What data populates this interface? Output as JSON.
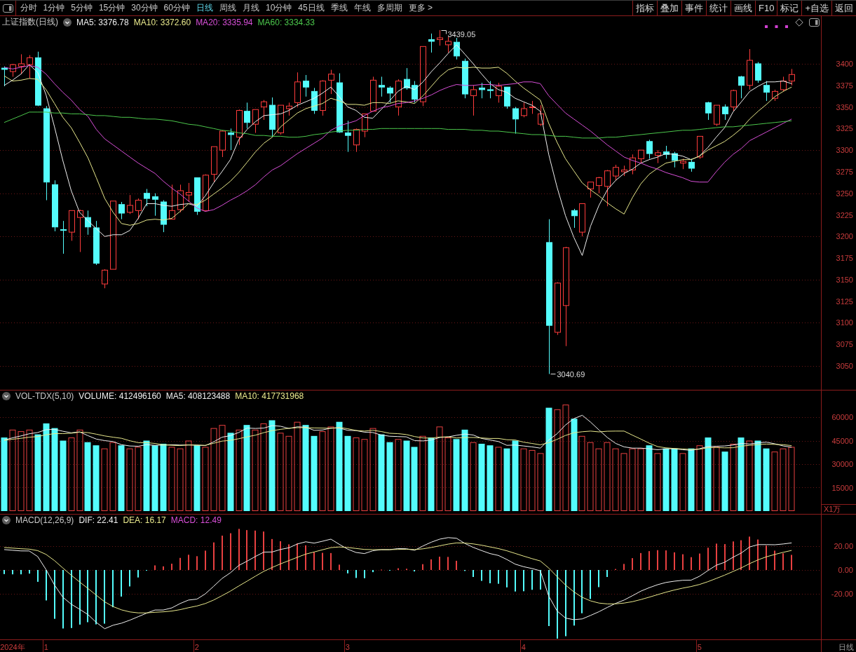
{
  "toolbar": {
    "periods": [
      {
        "label": "分时",
        "selected": false
      },
      {
        "label": "1分钟",
        "selected": false
      },
      {
        "label": "5分钟",
        "selected": false
      },
      {
        "label": "15分钟",
        "selected": false
      },
      {
        "label": "30分钟",
        "selected": false
      },
      {
        "label": "60分钟",
        "selected": false
      },
      {
        "label": "日线",
        "selected": true
      },
      {
        "label": "周线",
        "selected": false
      },
      {
        "label": "月线",
        "selected": false
      },
      {
        "label": "10分钟",
        "selected": false
      },
      {
        "label": "45日线",
        "selected": false
      },
      {
        "label": "季线",
        "selected": false
      },
      {
        "label": "年线",
        "selected": false
      },
      {
        "label": "多周期",
        "selected": false
      },
      {
        "label": "更多 >",
        "selected": false
      }
    ],
    "tools": [
      "指标",
      "叠加",
      "事件",
      "统计",
      "画线",
      "F10",
      "标记",
      "+自选",
      "返回"
    ]
  },
  "price_panel": {
    "title": "上证指数(日线)",
    "legend": [
      {
        "label": "MA5: 3376.78",
        "color": "#f0f0f0"
      },
      {
        "label": "MA10: 3372.60",
        "color": "#e8e88c"
      },
      {
        "label": "MA20: 3335.94",
        "color": "#d84fd8"
      },
      {
        "label": "MA60: 3334.33",
        "color": "#4cc84c"
      }
    ],
    "chart_data": {
      "type": "candlestick",
      "ylim": [
        3021.6,
        3456
      ],
      "grid": true,
      "yticks": [
        3050,
        3075,
        3100,
        3125,
        3150,
        3175,
        3200,
        3225,
        3250,
        3275,
        3300,
        3325,
        3350,
        3375,
        3400
      ],
      "categories": [
        null,
        null,
        null,
        null,
        null,
        null,
        null,
        null,
        null,
        null,
        null,
        null,
        null,
        null,
        null,
        null,
        null,
        null,
        null,
        null,
        null,
        null,
        null,
        null,
        null,
        null,
        null,
        null,
        null,
        null,
        null,
        null,
        null,
        null,
        null,
        null,
        null,
        null,
        null,
        null,
        null,
        null,
        null,
        null,
        null,
        null,
        null,
        null,
        null,
        null,
        null,
        null,
        null,
        null,
        null,
        null,
        null,
        null,
        null,
        null,
        null,
        null,
        null,
        null,
        null,
        null,
        null,
        null,
        null,
        null,
        null,
        null,
        null,
        null,
        null,
        null,
        null,
        null,
        null,
        null,
        null,
        null,
        null,
        null,
        null,
        null,
        null,
        null,
        null,
        null,
        null,
        null,
        null,
        null,
        null,
        null,
        null,
        null
      ],
      "ohlc": [
        [
          3395,
          3397,
          3374,
          3393.5
        ],
        [
          3391,
          3400,
          3385,
          3399
        ],
        [
          3397,
          3411,
          3388,
          3400
        ],
        [
          3399,
          3410,
          3383,
          3407
        ],
        [
          3407,
          3414,
          3351,
          3352
        ],
        [
          3348,
          3351,
          3242,
          3263
        ],
        [
          3260,
          3265,
          3206,
          3211
        ],
        [
          3208,
          3218,
          3180,
          3207
        ],
        [
          3205,
          3230,
          3195,
          3230
        ],
        [
          3222,
          3231,
          3182,
          3230
        ],
        [
          3222,
          3230,
          3202,
          3211
        ],
        [
          3210,
          3218,
          3167,
          3169
        ],
        [
          3145,
          3162,
          3140,
          3161
        ],
        [
          3162,
          3241,
          3162,
          3241
        ],
        [
          3237,
          3240,
          3220,
          3227
        ],
        [
          3228,
          3248,
          3226,
          3236
        ],
        [
          3230,
          3244,
          3220,
          3242
        ],
        [
          3250,
          3255,
          3235,
          3244
        ],
        [
          3246,
          3250,
          3224,
          3243
        ],
        [
          3240,
          3242,
          3205,
          3214
        ],
        [
          3220,
          3260,
          3220,
          3230
        ],
        [
          3231,
          3260,
          3228,
          3253
        ],
        [
          3248,
          3262,
          3240,
          3251
        ],
        [
          3268,
          3268,
          3225,
          3229
        ],
        [
          3230,
          3272,
          3230,
          3271
        ],
        [
          3272,
          3304,
          3263,
          3304
        ],
        [
          3300,
          3323,
          3292,
          3322
        ],
        [
          3320,
          3325,
          3300,
          3318
        ],
        [
          3315,
          3347,
          3306,
          3346
        ],
        [
          3345,
          3355,
          3325,
          3332
        ],
        [
          3330,
          3347,
          3320,
          3347
        ],
        [
          3350,
          3358,
          3335,
          3356
        ],
        [
          3352,
          3361,
          3315,
          3324
        ],
        [
          3320,
          3352,
          3318,
          3352
        ],
        [
          3348,
          3355,
          3340,
          3351
        ],
        [
          3355,
          3390,
          3350,
          3379
        ],
        [
          3380,
          3387,
          3362,
          3373
        ],
        [
          3368,
          3372,
          3342,
          3346
        ],
        [
          3346,
          3381,
          3340,
          3380
        ],
        [
          3381,
          3393,
          3365,
          3388
        ],
        [
          3378,
          3389,
          3320,
          3321
        ],
        [
          3320,
          3334,
          3298,
          3317
        ],
        [
          3306,
          3325,
          3298,
          3324
        ],
        [
          3322,
          3342,
          3315,
          3342
        ],
        [
          3345,
          3385,
          3345,
          3381
        ],
        [
          3375,
          3385,
          3362,
          3373
        ],
        [
          3372,
          3374,
          3355,
          3366
        ],
        [
          3350,
          3382,
          3340,
          3380
        ],
        [
          3382,
          3395,
          3370,
          3372
        ],
        [
          3375,
          3380,
          3355,
          3359
        ],
        [
          3356,
          3420,
          3351,
          3420
        ],
        [
          3428,
          3435,
          3413,
          3426
        ],
        [
          3428,
          3439.05,
          3421,
          3430
        ],
        [
          3422,
          3431,
          3413,
          3426
        ],
        [
          3425,
          3430,
          3405,
          3409
        ],
        [
          3403,
          3406,
          3360,
          3365
        ],
        [
          3363,
          3375,
          3340,
          3370
        ],
        [
          3372,
          3378,
          3360,
          3370
        ],
        [
          3370,
          3380,
          3360,
          3369
        ],
        [
          3363,
          3378,
          3355,
          3374
        ],
        [
          3373,
          3373,
          3348,
          3351
        ],
        [
          3348,
          3350,
          3319,
          3336
        ],
        [
          3340,
          3355,
          3338,
          3348
        ],
        [
          3350,
          3357,
          3342,
          3350
        ],
        [
          3330,
          3352,
          3328,
          3342
        ],
        [
          3193,
          3220,
          3040.69,
          3097
        ],
        [
          3089,
          3147,
          3086,
          3146
        ],
        [
          3120,
          3188,
          3073,
          3187
        ],
        [
          3230,
          3232,
          3210,
          3224
        ],
        [
          3205,
          3238,
          3200,
          3238
        ],
        [
          3255,
          3263,
          3245,
          3263
        ],
        [
          3259,
          3269,
          3250,
          3268
        ],
        [
          3258,
          3277,
          3235,
          3276
        ],
        [
          3270,
          3283,
          3265,
          3280
        ],
        [
          3275,
          3282,
          3270,
          3277
        ],
        [
          3277,
          3295,
          3272,
          3291
        ],
        [
          3290,
          3300,
          3285,
          3300
        ],
        [
          3310,
          3312,
          3290,
          3296
        ],
        [
          3294,
          3300,
          3285,
          3297
        ],
        [
          3298,
          3305,
          3290,
          3295
        ],
        [
          3296,
          3298,
          3280,
          3288
        ],
        [
          3285,
          3290,
          3278,
          3287
        ],
        [
          3286,
          3290,
          3275,
          3279
        ],
        [
          3292,
          3316,
          3290,
          3316
        ],
        [
          3355,
          3356,
          3335,
          3343
        ],
        [
          3330,
          3352,
          3328,
          3352
        ],
        [
          3350,
          3353,
          3335,
          3342
        ],
        [
          3350,
          3370,
          3345,
          3369
        ],
        [
          3385,
          3386,
          3360,
          3375
        ],
        [
          3375,
          3417,
          3370,
          3404
        ],
        [
          3400,
          3402,
          3378,
          3381
        ],
        [
          3375,
          3380,
          3357,
          3367
        ],
        [
          3360,
          3370,
          3357,
          3368
        ],
        [
          3370,
          3385,
          3368,
          3380
        ],
        [
          3380,
          3394,
          3375,
          3387.57
        ],
        null,
        null,
        null
      ],
      "annotations": [
        "3439.05",
        "3040.69"
      ]
    },
    "ma_overlay": {
      "chart_data": {
        "type": "line",
        "ylim": [
          3021.6,
          3456
        ],
        "series": [
          {
            "color": "#f0f0f0",
            "values": [
              3375,
              3381,
              3388,
              3399,
              3390,
              3364,
              3327,
              3288,
              3253,
              3228,
              3218,
              3209,
              3200,
              3202,
              3202,
              3207,
              3221,
              3238,
              3238,
              3236,
              3235,
              3237,
              3238,
              3235,
              3247,
              3262,
              3275,
              3289,
              3312,
              3324,
              3333,
              3340,
              3341,
              3342,
              3346,
              3352,
              3356,
              3360,
              3366,
              3373,
              3362,
              3350,
              3346,
              3338,
              3337,
              3347,
              3357,
              3368,
              3374,
              3370,
              3379,
              3391,
              3401,
              3412,
              3422,
              3411,
              3400,
              3388,
              3377,
              3370,
              3367,
              3360,
              3356,
              3352,
              3345,
              3295,
              3257,
              3224,
              3199,
              3178,
              3212,
              3236,
              3254,
              3265,
              3273,
              3278,
              3285,
              3289,
              3292,
              3296,
              3295,
              3293,
              3289,
              3293,
              3303,
              3315,
              3326,
              3344,
              3356,
              3368,
              3374,
              3379,
              3379,
              3380,
              3377,
              null,
              null,
              null
            ]
          },
          {
            "color": "#e8e88c",
            "values": [
              3386,
              3380,
              3381,
              3383,
              3382,
              3370,
              3354,
              3338,
              3326,
              3309,
              3291,
              3268,
              3244,
              3228,
              3215,
              3213,
              3215,
              3219,
              3220,
              3219,
              3221,
              3229,
              3238,
              3237,
              3242,
              3249,
              3256,
              3264,
              3274,
              3286,
              3298,
              3308,
              3315,
              3327,
              3335,
              3343,
              3348,
              3351,
              3354,
              3360,
              3357,
              3353,
              3353,
              3352,
              3355,
              3355,
              3354,
              3357,
              3356,
              3354,
              3363,
              3374,
              3385,
              3393,
              3396,
              3395,
              3396,
              3395,
              3395,
              3396,
              3389,
              3380,
              3372,
              3365,
              3358,
              3331,
              3309,
              3290,
              3276,
              3262,
              3254,
              3247,
              3239,
              3232,
              3226,
              3245,
              3261,
              3272,
              3279,
              3285,
              3287,
              3289,
              3289,
              3293,
              3300,
              3305,
              3310,
              3317,
              3325,
              3336,
              3345,
              3353,
              3362,
              3368,
              3373,
              null,
              null,
              null
            ]
          },
          {
            "color": "#d84fd8",
            "values": [
              3396,
              3394,
              3396,
              3398,
              3396,
              3388,
              3377,
              3367,
              3358,
              3347,
              3339,
              3324,
              3313,
              3306,
              3299,
              3292,
              3285,
              3279,
              3273,
              3264,
              3256,
              3249,
              3241,
              3233,
              3229,
              3231,
              3236,
              3242,
              3247,
              3253,
              3260,
              3269,
              3277,
              3282,
              3289,
              3296,
              3302,
              3308,
              3314,
              3323,
              3328,
              3331,
              3334,
              3340,
              3345,
              3349,
              3351,
              3354,
              3355,
              3357,
              3360,
              3364,
              3369,
              3373,
              3376,
              3375,
              3375,
              3376,
              3376,
              3375,
              3376,
              3377,
              3379,
              3379,
              3377,
              3363,
              3353,
              3343,
              3336,
              3329,
              3322,
              3314,
              3306,
              3299,
              3292,
              3288,
              3285,
              3281,
              3278,
              3274,
              3271,
              3268,
              3264,
              3263,
              3263,
              3275,
              3286,
              3295,
              3302,
              3311,
              3316,
              3321,
              3326,
              3331,
              3336,
              null,
              null,
              null
            ]
          },
          {
            "color": "#4cc84c",
            "values": [
              3332,
              3336,
              3340,
              3344,
              3344,
              3344,
              3343,
              3343,
              3342,
              3342,
              3341,
              3340,
              3340,
              3339,
              3338,
              3338,
              3337,
              3336,
              3336,
              3335,
              3334,
              3332,
              3330,
              3329,
              3327,
              3325,
              3323,
              3322,
              3320,
              3319,
              3317,
              3317,
              3316,
              3316,
              3315,
              3315,
              3316,
              3318,
              3319,
              3321,
              3322,
              3323,
              3323,
              3324,
              3324,
              3325,
              3325,
              3325,
              3325,
              3325,
              3325,
              3325,
              3325,
              3324,
              3324,
              3324,
              3323,
              3323,
              3322,
              3322,
              3321,
              3320,
              3319,
              3318,
              3318,
              3317,
              3316,
              3316,
              3315,
              3314,
              3314,
              3314,
              3315,
              3315,
              3316,
              3317,
              3318,
              3319,
              3320,
              3321,
              3322,
              3323,
              3323,
              3324,
              3325,
              3326,
              3327,
              3327,
              3328,
              3329,
              3330,
              3331,
              3332,
              3333,
              3334,
              null,
              null,
              null
            ]
          }
        ]
      }
    }
  },
  "volume_panel": {
    "title": "VOL-TDX(5,10)",
    "legend": [
      {
        "label": "VOLUME: 412496160",
        "color": "#f0f0f0"
      },
      {
        "label": "MA5: 408123488",
        "color": "#f0f0f0"
      },
      {
        "label": "MA10: 417731968",
        "color": "#e8e88c"
      }
    ],
    "unit": "X1万",
    "chart_data": {
      "type": "bar",
      "ylim": [
        -2239,
        77463
      ],
      "grid": true,
      "yticks": [
        15000,
        30000,
        45000,
        60000
      ],
      "series": [
        {
          "values": [
            47000,
            52000,
            51000,
            52000,
            49000,
            56000,
            53000,
            45000,
            47000,
            52000,
            44000,
            42000,
            40000,
            44000,
            42000,
            40000,
            41000,
            45000,
            42000,
            43000,
            41000,
            40000,
            45000,
            42000,
            41000,
            53000,
            55000,
            50000,
            52000,
            55000,
            52000,
            56000,
            58000,
            50000,
            48000,
            57000,
            55000,
            48000,
            51000,
            54000,
            57000,
            48000,
            47000,
            46000,
            53000,
            49000,
            44000,
            46000,
            45000,
            41000,
            48000,
            47000,
            54000,
            47000,
            46000,
            52000,
            44000,
            43000,
            42000,
            41000,
            40000,
            45000,
            40000,
            39000,
            37000,
            66000,
            65000,
            68000,
            59000,
            48000,
            44000,
            40000,
            44000,
            40000,
            37000,
            40000,
            40000,
            42000,
            37000,
            40000,
            40000,
            37000,
            40000,
            42000,
            47000,
            41000,
            38000,
            43000,
            47000,
            45000,
            45000,
            40000,
            38000,
            40000,
            41000,
            null,
            null,
            null
          ],
          "colors": [
            "#54fcfc",
            "#e84040",
            "#e84040",
            "#e84040",
            "#54fcfc",
            "#54fcfc",
            "#54fcfc",
            "#54fcfc",
            "#e84040",
            "#e84040",
            "#54fcfc",
            "#54fcfc",
            "#e84040",
            "#e84040",
            "#54fcfc",
            "#e84040",
            "#e84040",
            "#54fcfc",
            "#54fcfc",
            "#54fcfc",
            "#e84040",
            "#e84040",
            "#e84040",
            "#54fcfc",
            "#e84040",
            "#e84040",
            "#e84040",
            "#54fcfc",
            "#e84040",
            "#54fcfc",
            "#e84040",
            "#e84040",
            "#54fcfc",
            "#e84040",
            "#e84040",
            "#e84040",
            "#54fcfc",
            "#54fcfc",
            "#e84040",
            "#e84040",
            "#54fcfc",
            "#54fcfc",
            "#e84040",
            "#e84040",
            "#e84040",
            "#54fcfc",
            "#54fcfc",
            "#e84040",
            "#54fcfc",
            "#54fcfc",
            "#e84040",
            "#54fcfc",
            "#e84040",
            "#e84040",
            "#54fcfc",
            "#54fcfc",
            "#e84040",
            "#54fcfc",
            "#54fcfc",
            "#e84040",
            "#54fcfc",
            "#54fcfc",
            "#e84040",
            "#e84040",
            "#e84040",
            "#54fcfc",
            "#e84040",
            "#e84040",
            "#54fcfc",
            "#e84040",
            "#e84040",
            "#e84040",
            "#e84040",
            "#e84040",
            "#e84040",
            "#e84040",
            "#e84040",
            "#54fcfc",
            "#e84040",
            "#54fcfc",
            "#54fcfc",
            "#e84040",
            "#54fcfc",
            "#e84040",
            "#54fcfc",
            "#e84040",
            "#54fcfc",
            "#e84040",
            "#54fcfc",
            "#e84040",
            "#54fcfc",
            "#54fcfc",
            "#e84040",
            "#e84040",
            "#e84040",
            null,
            null,
            null
          ]
        }
      ]
    },
    "ma_overlay": {
      "chart_data": {
        "type": "line",
        "ylim": [
          -2239,
          77463
        ],
        "series": [
          {
            "color": "#f0f0f0",
            "values": [
              45400,
              46800,
              48000,
              49400,
              50200,
              52000,
              52200,
              51000,
              50000,
              50600,
              48200,
              46000,
              45000,
              44400,
              42400,
              41600,
              41400,
              42400,
              42000,
              42200,
              42400,
              42200,
              42200,
              42200,
              41800,
              44200,
              47200,
              48200,
              50200,
              53000,
              52800,
              53000,
              54600,
              54200,
              52800,
              53800,
              53600,
              51600,
              51800,
              53000,
              53000,
              51600,
              51400,
              50400,
              50200,
              48600,
              47800,
              47600,
              47400,
              45000,
              44800,
              45400,
              47000,
              47400,
              48400,
              49200,
              48600,
              46400,
              45400,
              44400,
              42000,
              42200,
              41600,
              41000,
              40200,
              45400,
              49400,
              55000,
              59000,
              61200,
              56800,
              51800,
              47000,
              43200,
              41000,
              40200,
              40200,
              39800,
              39200,
              39800,
              39800,
              39200,
              38800,
              39800,
              41200,
              41400,
              41600,
              42200,
              43200,
              42800,
              43600,
              44000,
              43000,
              41600,
              40800,
              null,
              null,
              null
            ]
          },
          {
            "color": "#e8e88c",
            "values": [
              45200,
              45900,
              46500,
              47200,
              47600,
              48700,
              49500,
              49500,
              49700,
              50400,
              50100,
              49100,
              48000,
              47200,
              46500,
              44900,
              43700,
              43700,
              43200,
              42300,
              42000,
              41800,
              42300,
              42100,
              42000,
              43300,
              44700,
              45200,
              46200,
              47400,
              48500,
              50100,
              51400,
              52200,
              52900,
              53300,
              53300,
              53100,
              53000,
              52900,
              53400,
              52600,
              51500,
              51100,
              51600,
              50800,
              49700,
              49500,
              48900,
              47600,
              46700,
              46600,
              47300,
              47400,
              46700,
              47000,
              47000,
              46700,
              46400,
              46400,
              45600,
              45400,
              44000,
              43200,
              42300,
              43700,
              45800,
              48300,
              50000,
              50700,
              51100,
              50600,
              51000,
              51100,
              51100,
              48500,
              46000,
              43400,
              41200,
              40400,
              40000,
              39700,
              39300,
              39500,
              40500,
              40600,
              40400,
              40500,
              41500,
              42000,
              42500,
              42800,
              42600,
              42400,
              41800,
              null,
              null,
              null
            ]
          }
        ]
      }
    }
  },
  "macd_panel": {
    "title": "MACD(12,26,9)",
    "legend": [
      {
        "label": "DIF: 22.41",
        "color": "#f0f0f0"
      },
      {
        "label": "DEA: 16.17",
        "color": "#e8e88c"
      },
      {
        "label": "MACD: 12.49",
        "color": "#d84fd8"
      }
    ],
    "chart_data": {
      "type": "bar",
      "ylim": [
        -58,
        46.4
      ],
      "grid": true,
      "yticks": [
        {
          "value": -20,
          "label": "-20.00"
        },
        {
          "value": 0,
          "label": "0.00"
        },
        {
          "value": 20,
          "label": "20.00"
        }
      ],
      "categories": [
        null,
        "2024年",
        null,
        null,
        null,
        "1",
        null,
        null,
        null,
        null,
        null,
        null,
        null,
        null,
        null,
        null,
        null,
        null,
        null,
        null,
        null,
        null,
        null,
        "2",
        null,
        null,
        null,
        null,
        null,
        null,
        null,
        null,
        null,
        null,
        null,
        null,
        null,
        null,
        null,
        null,
        null,
        "3",
        null,
        null,
        null,
        null,
        null,
        null,
        null,
        null,
        null,
        null,
        null,
        null,
        null,
        null,
        null,
        null,
        null,
        null,
        null,
        null,
        "4",
        null,
        null,
        null,
        null,
        null,
        null,
        null,
        null,
        null,
        null,
        null,
        null,
        null,
        null,
        null,
        null,
        null,
        null,
        null,
        null,
        "5",
        null,
        null,
        null,
        null,
        null,
        null,
        null,
        null,
        null,
        null,
        null,
        null,
        null,
        null
      ],
      "series": [
        {
          "values": [
            -3.4,
            -3.6,
            -3.6,
            -3,
            -9.8,
            -25.2,
            -40.4,
            -48.4,
            -48,
            -45.2,
            -43.2,
            -45,
            -44.4,
            -30.8,
            -22,
            -13.6,
            -6.2,
            -0.4,
            3.8,
            3,
            5.2,
            10,
            12.6,
            11.4,
            16,
            22.8,
            28.4,
            30.4,
            34,
            33,
            32.6,
            31.8,
            25.6,
            23.8,
            21.2,
            22,
            20.4,
            14.6,
            14.2,
            14,
            4.4,
            -2.8,
            -6.6,
            -6.8,
            -1.8,
            0.3,
            -0.2,
            1.4,
            1,
            -1.2,
            4.8,
            8.8,
            11,
            10.8,
            7.6,
            -0.8,
            -5.8,
            -9,
            -11,
            -11.4,
            -14.4,
            -17.8,
            -17.6,
            -16.4,
            -16.2,
            -46.4,
            -56.8,
            -54.8,
            -46,
            -35.8,
            -24,
            -14.2,
            -5.8,
            0.8,
            5,
            9.8,
            14,
            15.6,
            16.4,
            16.2,
            14.6,
            13,
            10.6,
            13.6,
            18.4,
            21.8,
            21.4,
            23.6,
            24.6,
            27.6,
            25.2,
            20.2,
            16,
            13.8,
            12.5,
            null,
            null,
            null
          ],
          "colors": [
            "#54fcfc",
            "#54fcfc",
            "#54fcfc",
            "#54fcfc",
            "#54fcfc",
            "#54fcfc",
            "#54fcfc",
            "#54fcfc",
            "#54fcfc",
            "#54fcfc",
            "#54fcfc",
            "#54fcfc",
            "#54fcfc",
            "#54fcfc",
            "#54fcfc",
            "#54fcfc",
            "#54fcfc",
            "#54fcfc",
            "#e84040",
            "#e84040",
            "#e84040",
            "#e84040",
            "#e84040",
            "#e84040",
            "#e84040",
            "#e84040",
            "#e84040",
            "#e84040",
            "#e84040",
            "#e84040",
            "#e84040",
            "#e84040",
            "#e84040",
            "#e84040",
            "#e84040",
            "#e84040",
            "#e84040",
            "#e84040",
            "#e84040",
            "#e84040",
            "#e84040",
            "#54fcfc",
            "#54fcfc",
            "#54fcfc",
            "#54fcfc",
            "#e84040",
            "#54fcfc",
            "#e84040",
            "#e84040",
            "#54fcfc",
            "#e84040",
            "#e84040",
            "#e84040",
            "#e84040",
            "#e84040",
            "#54fcfc",
            "#54fcfc",
            "#54fcfc",
            "#54fcfc",
            "#54fcfc",
            "#54fcfc",
            "#54fcfc",
            "#54fcfc",
            "#54fcfc",
            "#54fcfc",
            "#54fcfc",
            "#54fcfc",
            "#54fcfc",
            "#54fcfc",
            "#54fcfc",
            "#54fcfc",
            "#54fcfc",
            "#54fcfc",
            "#e84040",
            "#e84040",
            "#e84040",
            "#e84040",
            "#e84040",
            "#e84040",
            "#e84040",
            "#e84040",
            "#e84040",
            "#e84040",
            "#e84040",
            "#e84040",
            "#e84040",
            "#e84040",
            "#e84040",
            "#e84040",
            "#e84040",
            "#e84040",
            "#e84040",
            "#e84040",
            "#e84040",
            "#e84040",
            null,
            null,
            null
          ]
        }
      ]
    },
    "line_overlay": {
      "chart_data": {
        "type": "line",
        "ylim": [
          -58,
          46.4
        ],
        "series": [
          {
            "color": "#f0f0f0",
            "values": [
              16.9,
              16.3,
              15.8,
              15.7,
              11.1,
              0.3,
              -12.4,
              -22.5,
              -28.3,
              -32.5,
              -36.9,
              -43.4,
              -48.6,
              -45.7,
              -44,
              -41.5,
              -38.6,
              -35.7,
              -33.1,
              -33.1,
              -31.4,
              -27.8,
              -24.9,
              -24.1,
              -19.8,
              -13.5,
              -7.1,
              -2.3,
              3.7,
              7.3,
              11.2,
              14.8,
              14.9,
              17,
              18.4,
              21.5,
              23.3,
              22.2,
              23.8,
              25.5,
              21.2,
              17.2,
              14.5,
              13.6,
              15.9,
              16.8,
              16.8,
              17.7,
              17.6,
              16.3,
              19.9,
              23,
              25.5,
              26.8,
              26.2,
              21.9,
              18.7,
              16,
              13.6,
              12,
              8.7,
              4.8,
              2.7,
              1.2,
              -0.7,
              -21.6,
              -33.9,
              -39.8,
              -41.1,
              -40.5,
              -37.6,
              -34.5,
              -31,
              -27.6,
              -24.9,
              -21.3,
              -17.5,
              -14.7,
              -12.2,
              -10.3,
              -9.3,
              -8.5,
              -8.4,
              -5.2,
              -0.5,
              3.9,
              6.4,
              10.5,
              14.1,
              19.1,
              21,
              21,
              20.9,
              21.5,
              22.4,
              null,
              null,
              null
            ]
          },
          {
            "color": "#e8e88c",
            "values": [
              18.6,
              18.1,
              17.6,
              17.2,
              16,
              12.9,
              7.8,
              1.7,
              -4.3,
              -9.9,
              -15.3,
              -20.9,
              -26.4,
              -30.3,
              -33,
              -34.7,
              -35.5,
              -35.5,
              -35,
              -34.6,
              -34,
              -32.8,
              -31.2,
              -29.8,
              -27.8,
              -24.9,
              -21.3,
              -17.5,
              -13.3,
              -9.2,
              -5.1,
              -1.1,
              2.1,
              5.1,
              7.8,
              10.5,
              13.1,
              14.9,
              16.7,
              18.5,
              19,
              18.6,
              17.8,
              17,
              16.8,
              16.8,
              16.8,
              17,
              17.1,
              16.9,
              17.5,
              18.6,
              20,
              21.4,
              22.4,
              22.3,
              21.6,
              20.5,
              19.1,
              17.7,
              15.9,
              13.7,
              11.5,
              9.4,
              7.4,
              1.6,
              -5.5,
              -12.4,
              -18.1,
              -22.6,
              -25.6,
              -27.4,
              -28.1,
              -28,
              -27.4,
              -26.2,
              -24.5,
              -22.5,
              -20.4,
              -18.4,
              -16.6,
              -15,
              -13.7,
              -12,
              -9.7,
              -7,
              -4.3,
              -1.3,
              1.8,
              5.3,
              8.4,
              10.9,
              12.9,
              14.6,
              16.2,
              null,
              null,
              null
            ]
          }
        ]
      }
    }
  },
  "x_axis": {
    "period_label": "日线"
  }
}
